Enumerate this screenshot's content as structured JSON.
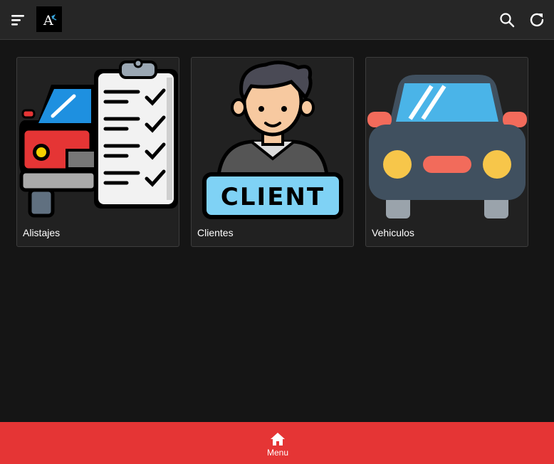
{
  "header": {
    "logo_letter": "A",
    "menu_icon": "hamburger-icon",
    "search_icon": "search-icon",
    "refresh_icon": "refresh-icon"
  },
  "cards": [
    {
      "label": "Alistajes",
      "image": "car-checklist-illustration"
    },
    {
      "label": "Clientes",
      "image": "client-illustration",
      "image_text": "CLIENT"
    },
    {
      "label": "Vehiculos",
      "image": "car-front-illustration"
    }
  ],
  "bottom_nav": {
    "menu_label": "Menu",
    "menu_icon": "home-icon"
  },
  "colors": {
    "background": "#151515",
    "topbar": "#262626",
    "card": "#212121",
    "accent_red": "#e53535"
  }
}
